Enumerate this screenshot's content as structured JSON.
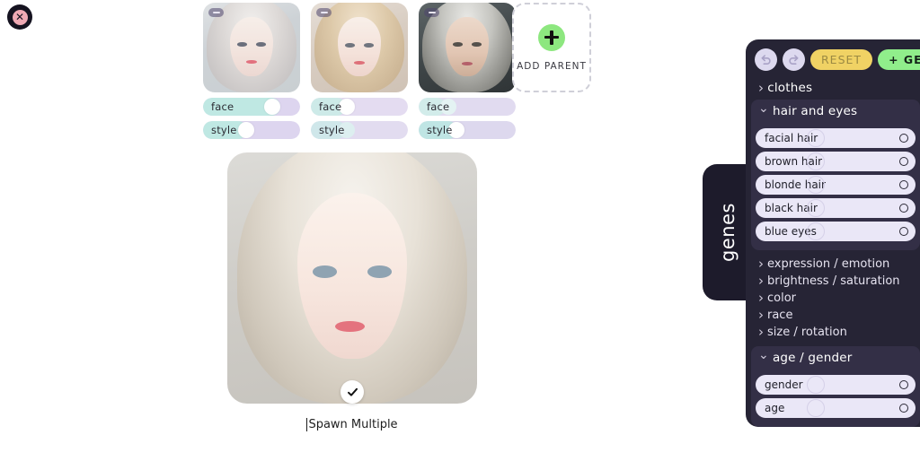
{
  "window": {
    "close_icon": "close-icon"
  },
  "parents": [
    {
      "id": "parent-1",
      "remove_icon": "minus-icon",
      "portrait_alt": "portrait-silver-hair-doll",
      "sliders": [
        {
          "label": "face",
          "value": 80,
          "track": "#ddd5ef",
          "fill": "#bfe8e3"
        },
        {
          "label": "style",
          "value": 45,
          "track": "#ddd5ef",
          "fill": "#bfe8e3"
        }
      ]
    },
    {
      "id": "parent-2",
      "remove_icon": "minus-icon",
      "portrait_alt": "portrait-blonde-curly",
      "sliders": [
        {
          "label": "face",
          "value": 36,
          "track": "#e4dcf1",
          "fill": "#cdeae8"
        },
        {
          "label": "style",
          "value": 36,
          "track": "#cfe7ea",
          "fill": "#cfe7ea"
        }
      ]
    },
    {
      "id": "parent-3",
      "remove_icon": "minus-icon",
      "portrait_alt": "portrait-warrior-braids",
      "sliders": [
        {
          "label": "face",
          "value": 28,
          "track": "#e1dbf0",
          "fill": "#d2ecea"
        },
        {
          "label": "style",
          "value": 40,
          "track": "#ddd8ee",
          "fill": "#bfe5e4"
        }
      ]
    }
  ],
  "add_parent": {
    "label": "ADD PARENT",
    "icon": "plus-icon",
    "accent": "#8de77f"
  },
  "preview": {
    "portrait_alt": "portrait-result-platinum-blonde",
    "confirm_icon": "check-icon",
    "spawn_label": "Spawn Multiple",
    "caret_visible": true
  },
  "genes_tab": {
    "label": "genes"
  },
  "genes_panel": {
    "toolbar": {
      "undo_icon": "undo-icon",
      "redo_icon": "redo-icon",
      "reset_label": "RESET",
      "reset_color": "#f0d264",
      "add_genes_label": "+ GENES",
      "add_genes_color": "#90ee8b"
    },
    "sections": [
      {
        "title": "clothes",
        "expanded": false,
        "genes": []
      },
      {
        "title": "hair and eyes",
        "expanded": true,
        "genes": [
          {
            "label": "facial hair",
            "knob": 32,
            "toggle": "circle"
          },
          {
            "label": "brown hair",
            "knob": 32,
            "toggle": "circle"
          },
          {
            "label": "blonde hair",
            "knob": 32,
            "toggle": "circle"
          },
          {
            "label": "black hair",
            "knob": 32,
            "toggle": "circle"
          },
          {
            "label": "blue eyes",
            "knob": 32,
            "toggle": "circle"
          }
        ]
      },
      {
        "title": "expression / emotion",
        "expanded": false,
        "genes": []
      },
      {
        "title": "brightness / saturation",
        "expanded": false,
        "genes": []
      },
      {
        "title": "color",
        "expanded": false,
        "genes": []
      },
      {
        "title": "race",
        "expanded": false,
        "genes": []
      },
      {
        "title": "size / rotation",
        "expanded": false,
        "genes": []
      },
      {
        "title": "age / gender",
        "expanded": true,
        "genes": [
          {
            "label": "gender",
            "knob": 32,
            "toggle": "circle"
          },
          {
            "label": "age",
            "knob": 32,
            "toggle": "circle"
          }
        ]
      }
    ]
  }
}
